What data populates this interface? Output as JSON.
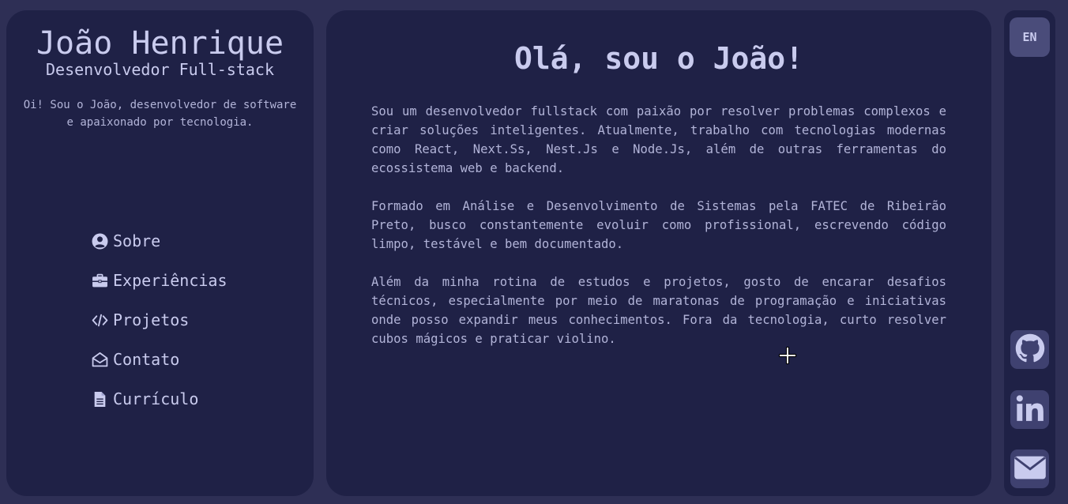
{
  "profile": {
    "name": "João Henrique",
    "role": "Desenvolvedor Full-stack",
    "bio": "Oi! Sou o João, desenvolvedor de software e apaixonado por tecnologia."
  },
  "nav": {
    "items": [
      {
        "label": "Sobre",
        "icon": "user-circle-icon"
      },
      {
        "label": "Experiências",
        "icon": "briefcase-icon"
      },
      {
        "label": "Projetos",
        "icon": "code-icon"
      },
      {
        "label": "Contato",
        "icon": "envelope-open-icon"
      },
      {
        "label": "Currículo",
        "icon": "file-icon"
      }
    ]
  },
  "main": {
    "title": "Olá, sou o João!",
    "paragraphs": [
      "Sou um desenvolvedor fullstack com paixão por resolver problemas complexos e criar soluções inteligentes. Atualmente, trabalho com tecnologias modernas como React, Next.Ss, Nest.Js e Node.Js, além de outras ferramentas do ecossistema web e backend.",
      "Formado em Análise e Desenvolvimento de Sistemas pela FATEC de Ribeirão Preto, busco constantemente evoluir como profissional, escrevendo código limpo, testável e bem documentado.",
      "Além da minha rotina de estudos e projetos, gosto de encarar desafios técnicos, especialmente por meio de maratonas de programação e iniciativas onde posso expandir meus conhecimentos. Fora da tecnologia, curto resolver cubos mágicos e praticar violino."
    ]
  },
  "rail": {
    "language_label": "EN",
    "socials": [
      {
        "icon": "github-icon"
      },
      {
        "icon": "linkedin-icon"
      },
      {
        "icon": "mail-icon"
      }
    ]
  },
  "colors": {
    "background": "#2e2f55",
    "panel": "#1f2146",
    "text": "#c9cbee",
    "button": "#4a4c7a"
  }
}
